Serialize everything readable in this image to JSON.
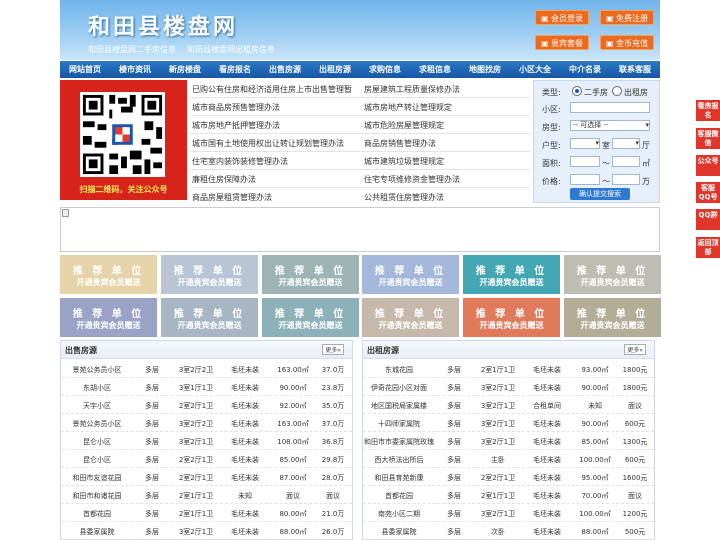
{
  "header": {
    "title": "和田县楼盘网",
    "sub1": "和田县楼盘网二手房信息",
    "sub2": "和田县楼盘网出租房信息",
    "buttons": [
      "会员登录",
      "免费注册",
      "贵宾套餐",
      "金币充值"
    ]
  },
  "nav": [
    "网站首页",
    "楼市资讯",
    "新房楼盘",
    "看房报名",
    "出售房源",
    "出租房源",
    "求购信息",
    "求租信息",
    "地图找房",
    "小区大全",
    "中介名录",
    "联系客服"
  ],
  "qr_caption": "扫描二维码，关注公众号",
  "news_left": [
    "已购公有住房和经济适用住房上市出售管理暂",
    "城市商品房预售管理办法",
    "城市房地产抵押管理办法",
    "城市国有土地使用权出让转让规划管理办法",
    "住宅室内装饰装修管理办法",
    "廉租住房保障办法",
    "商品房屋租赁管理办法"
  ],
  "news_right": [
    "房屋建筑工程质量保修办法",
    "城市房地产转让管理规定",
    "城市危险房屋管理规定",
    "商品房销售管理办法",
    "城市建筑垃圾管理规定",
    "住宅专项维修资金管理办法",
    "公共租赁住房管理办法"
  ],
  "search": {
    "type_label": "类型:",
    "opt1": "二手房",
    "opt2": "出租房",
    "community_label": "小区:",
    "housetype_label": "房型:",
    "select_default": "-- 可选择 --",
    "layout_label": "户型:",
    "room": "室",
    "hall": "厅",
    "area_label": "面积:",
    "area_unit": "㎡",
    "price_label": "价格:",
    "tilde": "〜",
    "price_unit": "万",
    "submit": "确认提交搜索"
  },
  "ads": {
    "title": "推 荐 单 位",
    "subtitle": "开通贵宾会员赠送",
    "colors": [
      "#e5d3aa",
      "#b9c4d4",
      "#9eb3b3",
      "#a4b8db",
      "#43a7b4",
      "#bfbcb4",
      "#9aa3c6",
      "#a7b5c5",
      "#8db1b8",
      "#c6b9ab",
      "#e07a5b",
      "#b3ad98"
    ]
  },
  "sale": {
    "title": "出售房源",
    "more": "更多»",
    "rows": [
      [
        "景苑公务员小区",
        "多层",
        "3室2厅2卫",
        "毛坯未装",
        "163.00㎡",
        "37.0万"
      ],
      [
        "东胡小区",
        "多层",
        "3室1厅1卫",
        "毛坯未装",
        "90.00㎡",
        "23.8万"
      ],
      [
        "天宇小区",
        "多层",
        "2室2厅1卫",
        "毛坯未装",
        "92.00㎡",
        "35.0万"
      ],
      [
        "景苑公务员小区",
        "多层",
        "3室2厅2卫",
        "毛坯未装",
        "163.00㎡",
        "37.0万"
      ],
      [
        "昆仑小区",
        "多层",
        "3室2厅1卫",
        "毛坯未装",
        "108.00㎡",
        "36.8万"
      ],
      [
        "昆仑小区",
        "多层",
        "2室2厅1卫",
        "毛坯未装",
        "85.00㎡",
        "29.8万"
      ],
      [
        "和田市友谊花园",
        "多层",
        "2室2厅1卫",
        "毛坯未装",
        "87.00㎡",
        "28.0万"
      ],
      [
        "和田市和诸花园",
        "多层",
        "2室1厅1卫",
        "未知",
        "面议",
        "面议"
      ],
      [
        "首都花园",
        "多层",
        "2室1厅1卫",
        "毛坯未装",
        "80.00㎡",
        "21.0万"
      ],
      [
        "县委家属院",
        "多层",
        "3室2厅1卫",
        "毛坯未装",
        "88.00㎡",
        "26.0万"
      ]
    ]
  },
  "rent": {
    "title": "出租房源",
    "more": "更多»",
    "rows": [
      [
        "东城花园",
        "多层",
        "2室1厅1卫",
        "毛坯未装",
        "93.00㎡",
        "1800元"
      ],
      [
        "伊奇花园小区对面",
        "多层",
        "3室2厅1卫",
        "毛坯未装",
        "90.00㎡",
        "1800元"
      ],
      [
        "地区国税局家属楼",
        "多层",
        "3室2厅1卫",
        "合租单间",
        "未知",
        "面议"
      ],
      [
        "十四师家属院",
        "多层",
        "3室2厅1卫",
        "毛坯未装",
        "90.00㎡",
        "600元"
      ],
      [
        "和田市市委家属院玫瑰",
        "多层",
        "3室2厅1卫",
        "毛坯未装",
        "85.00㎡",
        "1300元"
      ],
      [
        "西大桥法出所后",
        "多层",
        "主卧",
        "毛坯未装",
        "100.00㎡",
        "600元"
      ],
      [
        "和田县育苑新康",
        "多层",
        "2室2厅1卫",
        "毛坯未装",
        "95.00㎡",
        "1600元"
      ],
      [
        "首都花园",
        "多层",
        "2室1厅1卫",
        "毛坯未装",
        "70.00㎡",
        "面议"
      ],
      [
        "南苑小区二期",
        "多层",
        "3室2厅1卫",
        "毛坯未装",
        "100.00㎡",
        "1200元"
      ],
      [
        "县委家属院",
        "多层",
        "次卧",
        "毛坯未装",
        "88.00㎡",
        "500元"
      ]
    ]
  },
  "sidebar": [
    "看房报名",
    "客服微信",
    "公众号",
    "客服QQ号",
    "QQ群",
    "返回顶部"
  ],
  "colors": {
    "nav": "#1a5fab",
    "accent": "#ec6a1e",
    "qr_bg": "#d8231b",
    "side": "#e0352b"
  }
}
